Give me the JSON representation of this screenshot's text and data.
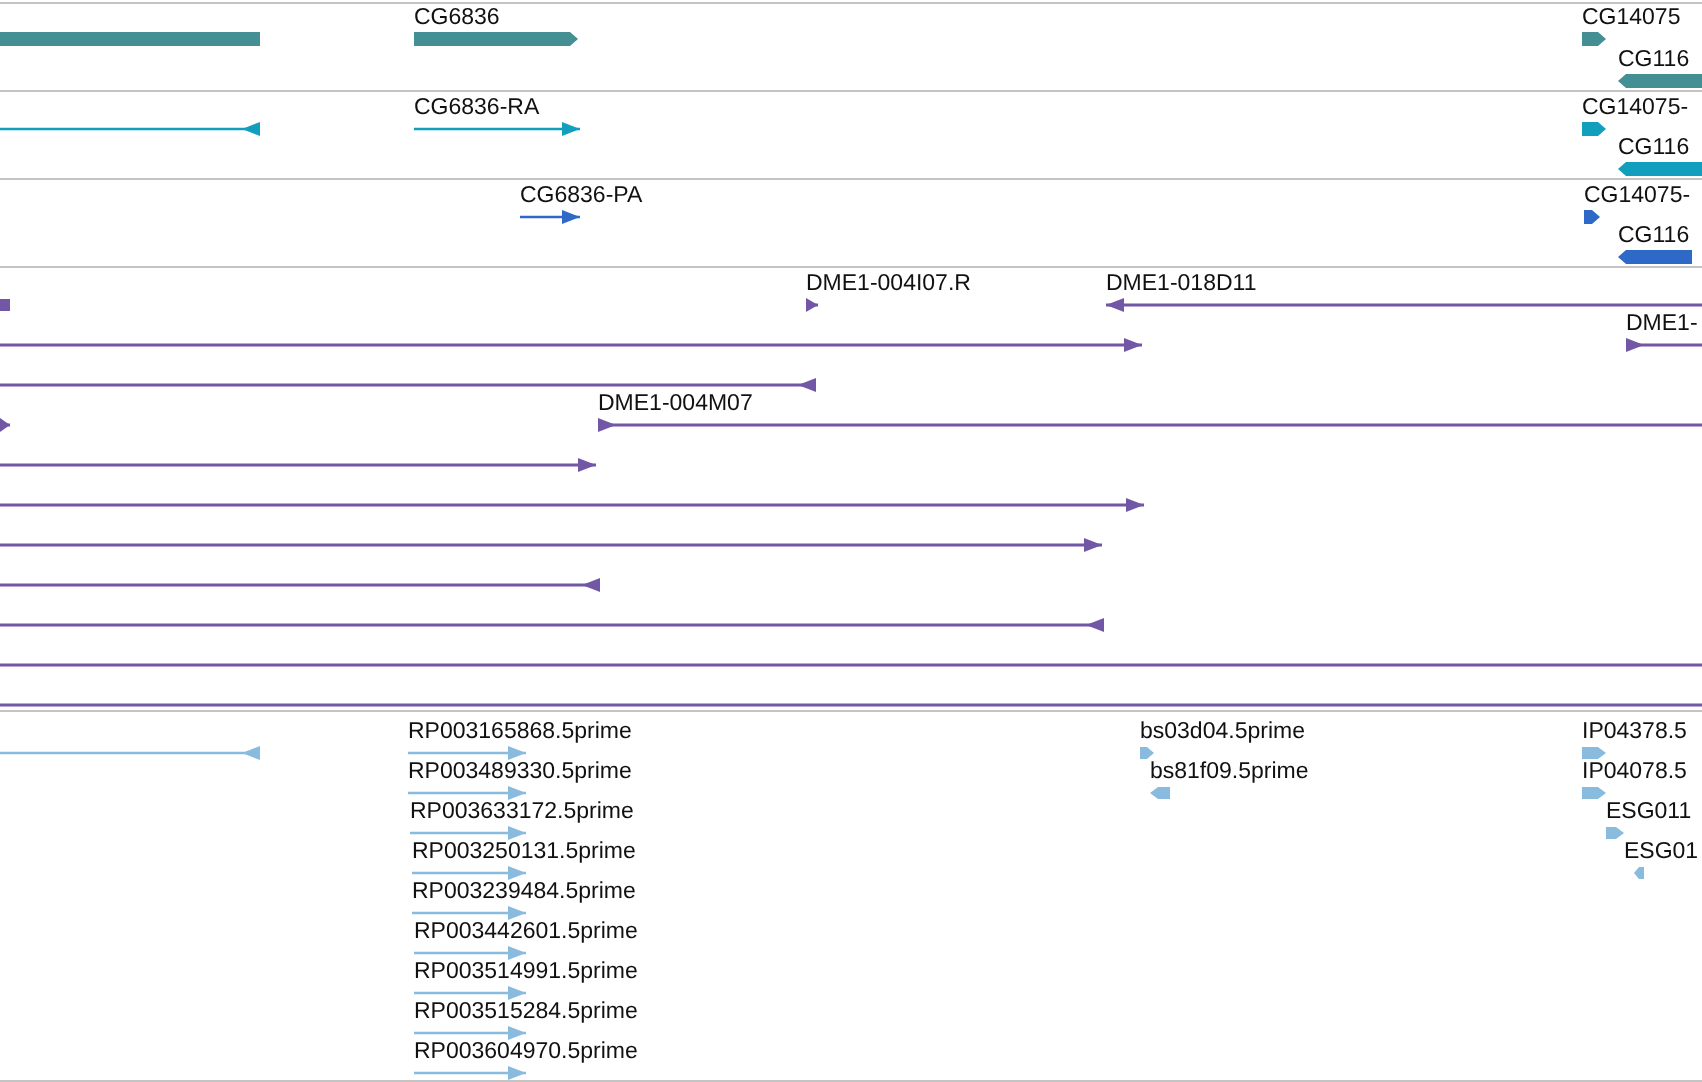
{
  "tracks": [
    {
      "kind": "gene",
      "color": "#438f94",
      "features": [
        {
          "kind": "bar"
        },
        {
          "kind": "bar",
          "label": "CG6836",
          "reverse": false
        },
        {
          "kind": "bar",
          "label": "CG14075",
          "reverse": false
        },
        {
          "kind": "bar",
          "label": "CG116",
          "reverse": true
        }
      ]
    },
    {
      "kind": "transcript",
      "color": "#129fbe",
      "features": [
        {
          "kind": "line",
          "reverse": true
        },
        {
          "kind": "line",
          "label": "CG6836-RA",
          "reverse": false
        },
        {
          "kind": "bar",
          "label": "CG14075-",
          "reverse": false
        },
        {
          "kind": "bar",
          "label": "CG116",
          "reverse": true
        }
      ]
    },
    {
      "kind": "protein",
      "color": "#2f69c8",
      "features": [
        {
          "kind": "line",
          "label": "CG6836-PA",
          "reverse": false
        },
        {
          "kind": "bar",
          "label": "CG14075-",
          "reverse": false
        },
        {
          "kind": "bar",
          "label": "CG116",
          "reverse": true
        }
      ]
    },
    {
      "kind": "clone",
      "color": "#7157a6",
      "features": [
        {
          "kind": "bar"
        },
        {
          "kind": "line",
          "label": "DME1-004I07.R",
          "reverse": false
        },
        {
          "kind": "line",
          "label": "DME1-018D11",
          "reverse": true
        },
        {
          "kind": "line",
          "reverse": false
        },
        {
          "kind": "line",
          "label": "DME1-",
          "reverse": false
        },
        {
          "kind": "line",
          "reverse": true
        },
        {
          "kind": "line",
          "reverse": false
        },
        {
          "kind": "line",
          "label": "DME1-004M07",
          "reverse": false
        },
        {
          "kind": "line",
          "reverse": false
        },
        {
          "kind": "line",
          "reverse": false
        },
        {
          "kind": "line",
          "reverse": false
        },
        {
          "kind": "line",
          "reverse": true
        },
        {
          "kind": "line",
          "reverse": true
        },
        {
          "kind": "line"
        },
        {
          "kind": "line"
        }
      ]
    },
    {
      "kind": "est",
      "color": "#88bbde",
      "features": [
        {
          "kind": "line",
          "reverse": true
        },
        {
          "kind": "line",
          "label": "RP003165868.5prime",
          "reverse": false
        },
        {
          "kind": "bar",
          "label": "bs03d04.5prime",
          "reverse": false
        },
        {
          "kind": "bar",
          "label": "IP04378.5",
          "reverse": false
        },
        {
          "kind": "line",
          "label": "RP003489330.5prime",
          "reverse": false
        },
        {
          "kind": "bar",
          "label": "bs81f09.5prime",
          "reverse": true
        },
        {
          "kind": "bar",
          "label": "IP04078.5",
          "reverse": false
        },
        {
          "kind": "line",
          "label": "RP003633172.5prime",
          "reverse": false
        },
        {
          "kind": "bar",
          "label": "ESG011",
          "reverse": false
        },
        {
          "kind": "line",
          "label": "RP003250131.5prime",
          "reverse": false
        },
        {
          "kind": "bar",
          "label": "ESG01",
          "reverse": true
        },
        {
          "kind": "line",
          "label": "RP003239484.5prime",
          "reverse": false
        },
        {
          "kind": "line",
          "label": "RP003442601.5prime",
          "reverse": false
        },
        {
          "kind": "line",
          "label": "RP003514991.5prime",
          "reverse": false
        },
        {
          "kind": "line",
          "label": "RP003515284.5prime",
          "reverse": false
        },
        {
          "kind": "line",
          "label": "RP003604970.5prime",
          "reverse": false
        }
      ]
    }
  ]
}
